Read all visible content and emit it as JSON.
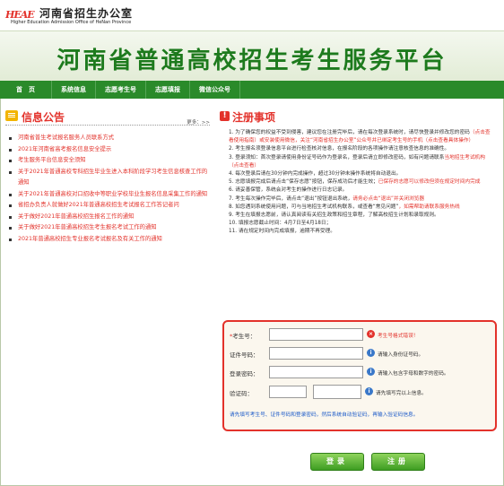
{
  "office": {
    "logo_text": "HEAE",
    "name": "河南省招生办公室",
    "en_name": "Higher Education Admission Office of HeNan Province"
  },
  "banner": {
    "title": "河南省普通高校招生考生服务平台"
  },
  "nav": [
    {
      "label": "首　页"
    },
    {
      "label": "系统信息"
    },
    {
      "label": "志愿考生号"
    },
    {
      "label": "志愿填报"
    },
    {
      "label": "微信公众号"
    }
  ],
  "news": {
    "title": "信息公告",
    "more": "更多：>>",
    "items": [
      "河南省普生考试报名服务人员联系方式",
      "2021年河南省高考报名信息安全提示",
      "考生服务平台信息安全须知",
      "关于2021年普通高校专科招生毕业生进入本科阶段学习考生信息核查工作的通知",
      "关于2021年普通高校对口招收中等职业学校毕业生报名信息采集工作的通知",
      "省招办负责人就做好2021年普通高校招生考试报名工作答记者问",
      "关于做好2021年普通高校招生报名工作的通知",
      "关于做好2021年普通高校招生考生报名考试工作的通知",
      "2021年普通高校招生专业报名考试报名及有关工作的通知"
    ]
  },
  "notice": {
    "title": "注册事项",
    "rules": [
      {
        "text": "为了确保您的权益不受到侵害，建议您在注册完毕后，请在每次登录系统时，请尽快登录并修改您的密码",
        "red": "（点击查看使用指南）或安装使用微信，关注“河南省招生办公室”公众号并已绑定考生号的手机（点击查看具体操作）"
      },
      {
        "text": "考生报名须登录信息平台进行检查核对信息，在报名阶段的各项操作请注意核查信息的准确性。",
        "red": ""
      },
      {
        "text": "登录须知：首次登录请使用身份证号码作为登录名，登录后请立即修改密码，如有问题请联系",
        "red": "当地招生考试机构（点击查看）"
      },
      {
        "text": "每次登录后请在30分钟内完成操作，超过30分钟未操作系统将自动退出。",
        "red": ""
      },
      {
        "text": "志愿填报完成后请点击“保存志愿”按钮，保存成功后才能生效；",
        "red": "已保存的志愿可以修改但须在规定时间内完成"
      },
      {
        "text": "请妥善保管，系统会对考生的操作进行日志记录。",
        "red": ""
      },
      {
        "text": "考生每次操作完毕后，请点击“退出”按钮退出系统，",
        "red": "请务必点击“退出”并关闭浏览器"
      },
      {
        "text": "如您遇到系统使用问题，可与当地招生考试机构联系，或查看“常见问题”",
        "red": "，如需帮助请联系服务热线"
      },
      {
        "text": "考生在填报志愿前，请认真阅读有关招生政策和招生章程，了解高校招生计划和录取规则。",
        "red": ""
      },
      {
        "text": "填报志愿截止时间：4月7日至4月18日；",
        "red": ""
      },
      {
        "text": "请在规定时间内完成填报，逾期不再受理。",
        "red": ""
      }
    ]
  },
  "login": {
    "rows": [
      {
        "label": "考生号：",
        "value": "",
        "hint": "考生号格式错误！",
        "hint_type": "error"
      },
      {
        "label": "证件号码：",
        "value": "",
        "hint": "请输入身份证号码。",
        "hint_type": "info"
      },
      {
        "label": "登录密码：",
        "value": "",
        "hint": "请输入包含字母和数字的密码。",
        "hint_type": "info"
      },
      {
        "label": "验证码：",
        "value": "",
        "hint": "请先填写完以上信息。",
        "hint_type": "info"
      }
    ],
    "note": "请先填写考生号、证件号码和登录密码，然后系统自动验证码，再输入验证码信息。",
    "login_button": "登录",
    "register_button": "注册"
  },
  "colors": {
    "brand_green": "#2a8a2a",
    "title_green": "#1d7a1d",
    "alert_red": "#e3322b",
    "link_blue": "#1a59c8"
  }
}
